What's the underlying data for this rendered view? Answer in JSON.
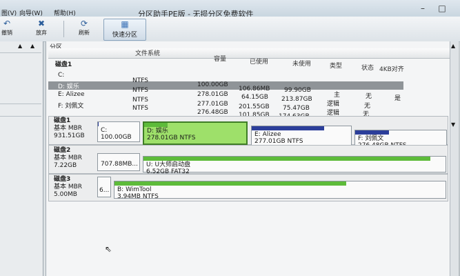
{
  "menu": {
    "items": [
      "图(V)",
      "向导(W)",
      "帮助(H)"
    ]
  },
  "window": {
    "title": "分区助手PE版 - 无损分区免费软件"
  },
  "toolbar": {
    "undo_label": "撤销",
    "discard_label": "放弃",
    "refresh_label": "刷新",
    "quick_label": "快速分区"
  },
  "pane": {
    "header": "分区"
  },
  "columns": [
    "文件系统",
    "容量",
    "已使用",
    "未使用",
    "类型",
    "状态",
    "4KB对齐"
  ],
  "disk1_title": "磁盘1",
  "partitions": [
    {
      "name": "C:",
      "fs": "NTFS",
      "cap": "100.00GB",
      "used": "106.86MB",
      "free": "99.90GB",
      "type": "",
      "status": "",
      "align": ""
    },
    {
      "name": "D: 娱乐",
      "fs": "NTFS",
      "cap": "278.01GB",
      "used": "64.15GB",
      "free": "213.87GB",
      "type": "主",
      "status": "无",
      "align": "是"
    },
    {
      "name": "E: Alizee",
      "fs": "NTFS",
      "cap": "277.01GB",
      "used": "201.55GB",
      "free": "75.47GB",
      "type": "逻辑",
      "status": "无",
      "align": ""
    },
    {
      "name": "F: 刘佩文",
      "fs": "NTFS",
      "cap": "276.48GB",
      "used": "101.85GB",
      "free": "174.63GB",
      "type": "逻辑",
      "status": "无",
      "align": ""
    }
  ],
  "disks": [
    {
      "name": "磁盘1",
      "type": "基本 MBR",
      "size": "931.51GB",
      "parts": [
        {
          "label": "C:",
          "detail": "100.00GB",
          "used": 0.01
        },
        {
          "label": "D: 娱乐",
          "detail": "278.01GB NTFS",
          "used": 0.23
        },
        {
          "label": "E: Alizee",
          "detail": "277.01GB NTFS",
          "used": 0.73
        },
        {
          "label": "F: 刘佩文",
          "detail": "276.48GB NTFS",
          "used": 0.37
        }
      ]
    },
    {
      "name": "磁盘2",
      "type": "基本 MBR",
      "size": "7.22GB",
      "parts": [
        {
          "label": "",
          "detail": "707.88MB...",
          "used": 0
        },
        {
          "label": "U: U大师启动盘",
          "detail": "6.52GB FAT32",
          "used": 0.95
        }
      ]
    },
    {
      "name": "磁盘3",
      "type": "基本 MBR",
      "size": "5.00MB",
      "parts": [
        {
          "label": "",
          "detail": "6...",
          "used": 0
        },
        {
          "label": "B: WimTool",
          "detail": "3.94MB NTFS",
          "used": 0.7
        }
      ]
    }
  ],
  "colors": {
    "green": "#5dbb3a",
    "blue": "#2c3e9a",
    "selected": "#9ee06a"
  }
}
